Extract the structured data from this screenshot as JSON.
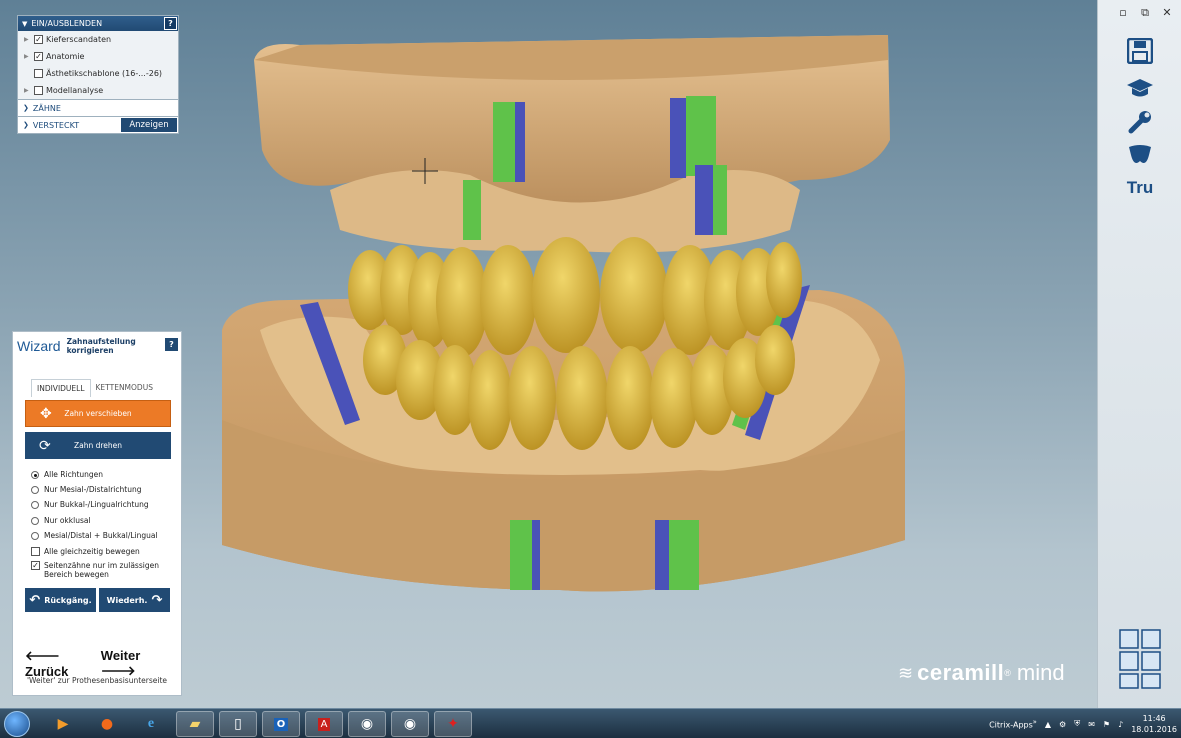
{
  "window_controls": {
    "minimize": "▫",
    "restore": "⧉",
    "close": "✕"
  },
  "show_hide_panel": {
    "header": "EIN/AUSBLENDEN",
    "help": "?",
    "items": [
      {
        "label": "Kieferscandaten",
        "checked": true
      },
      {
        "label": "Anatomie",
        "checked": true
      },
      {
        "label": "Ästhetikschablone (16-...-26)",
        "checked": false
      },
      {
        "label": "Modellanalyse",
        "checked": false
      }
    ],
    "sections": {
      "teeth": "ZÄHNE",
      "hidden": "VERSTECKT",
      "show_button": "Anzeigen"
    }
  },
  "wizard": {
    "title": "Wizard",
    "subtitle": "Zahnaufstellung korrigieren",
    "help": "?",
    "tabs": [
      "INDIVIDUELL",
      "KETTENMODUS"
    ],
    "move_button": "Zahn verschieben",
    "rotate_button": "Zahn drehen",
    "radio_options": [
      {
        "label": "Alle Richtungen",
        "selected": true
      },
      {
        "label": "Nur Mesial-/Distalrichtung",
        "selected": false
      },
      {
        "label": "Nur Bukkal-/Lingualrichtung",
        "selected": false
      },
      {
        "label": "Nur okklusal",
        "selected": false
      },
      {
        "label": "Mesial/Distal + Bukkal/Lingual",
        "selected": false
      }
    ],
    "checkbox_options": [
      {
        "label": "Alle gleichzeitig bewegen",
        "checked": false
      },
      {
        "label": "Seitenzähne nur im zulässigen Bereich bewegen",
        "checked": true
      }
    ],
    "undo": "Rückgäng.",
    "redo": "Wiederh.",
    "back": "Zurück",
    "next": "Weiter",
    "hint": "'Weiter' zur Prothesenbasisunterseite"
  },
  "brand": {
    "bold": "ceramill",
    "reg": "®",
    "light": "mind"
  },
  "rightbar": {
    "tru": "Tru"
  },
  "taskbar": {
    "citrix": "Citrix-Apps",
    "time": "11:46",
    "date": "18.01.2016",
    "chevron": "»"
  },
  "colors": {
    "accent_blue": "#214a73",
    "orange": "#ec7a26",
    "stripe_green": "#5fc24a",
    "stripe_blue": "#4a52b8",
    "model": "#d9b07c",
    "teeth": "#d8b93a"
  }
}
